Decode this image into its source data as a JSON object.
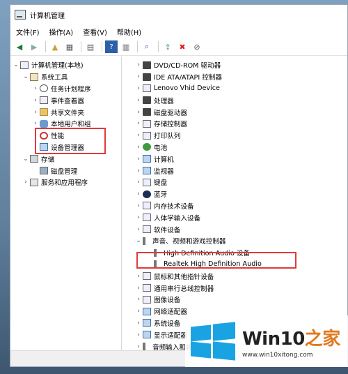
{
  "window": {
    "title": "计算机管理"
  },
  "menu": [
    "文件(F)",
    "操作(A)",
    "查看(V)",
    "帮助(H)"
  ],
  "toolbar_icons": [
    "back-icon",
    "forward-icon",
    "up-icon",
    "show-hide-tree-icon",
    "export-icon",
    "help-icon",
    "properties-icon",
    "scan-hardware-icon",
    "update-driver-icon",
    "uninstall-icon",
    "disable-icon"
  ],
  "left_tree": [
    {
      "label": "计算机管理(本地)",
      "level": 0,
      "chev": "∨",
      "icon": "computer-management-icon",
      "iconClass": "plain"
    },
    {
      "label": "系统工具",
      "level": 1,
      "chev": "∨",
      "icon": "system-tools-icon",
      "iconClass": "tools"
    },
    {
      "label": "任务计划程序",
      "level": 2,
      "chev": ">",
      "icon": "clock-icon",
      "iconClass": "clock"
    },
    {
      "label": "事件查看器",
      "level": 2,
      "chev": ">",
      "icon": "event-viewer-icon",
      "iconClass": "plain"
    },
    {
      "label": "共享文件夹",
      "level": 2,
      "chev": ">",
      "icon": "shared-folder-icon",
      "iconClass": "folder"
    },
    {
      "label": "本地用户和组",
      "level": 2,
      "chev": ">",
      "icon": "users-icon",
      "iconClass": "users"
    },
    {
      "label": "性能",
      "level": 2,
      "chev": ">",
      "icon": "performance-icon",
      "iconClass": "gauge"
    },
    {
      "label": "设备管理器",
      "level": 2,
      "chev": "",
      "icon": "device-manager-icon",
      "iconClass": "monitor"
    },
    {
      "label": "存储",
      "level": 1,
      "chev": "∨",
      "icon": "storage-icon",
      "iconClass": "storage"
    },
    {
      "label": "磁盘管理",
      "level": 2,
      "chev": "",
      "icon": "disk-management-icon",
      "iconClass": "disk"
    },
    {
      "label": "服务和应用程序",
      "level": 1,
      "chev": ">",
      "icon": "services-icon",
      "iconClass": "service"
    }
  ],
  "right_tree": [
    {
      "label": "DVD/CD-ROM 驱动器",
      "level": 0,
      "chev": ">",
      "icon": "dvd-icon",
      "iconClass": "dark"
    },
    {
      "label": "IDE ATA/ATAPI 控制器",
      "level": 0,
      "chev": ">",
      "icon": "ide-icon",
      "iconClass": "dark"
    },
    {
      "label": "Lenovo Vhid Device",
      "level": 0,
      "chev": ">",
      "icon": "hid-icon",
      "iconClass": "plain"
    },
    {
      "label": "处理器",
      "level": 0,
      "chev": ">",
      "icon": "processor-icon",
      "iconClass": "dark"
    },
    {
      "label": "磁盘驱动器",
      "level": 0,
      "chev": ">",
      "icon": "disk-drive-icon",
      "iconClass": "dark"
    },
    {
      "label": "存储控制器",
      "level": 0,
      "chev": ">",
      "icon": "storage-controller-icon",
      "iconClass": "plain"
    },
    {
      "label": "打印队列",
      "level": 0,
      "chev": ">",
      "icon": "printer-icon",
      "iconClass": "plain"
    },
    {
      "label": "电池",
      "level": 0,
      "chev": ">",
      "icon": "battery-icon",
      "iconClass": "green"
    },
    {
      "label": "计算机",
      "level": 0,
      "chev": ">",
      "icon": "computer-icon",
      "iconClass": "monitor"
    },
    {
      "label": "监视器",
      "level": 0,
      "chev": ">",
      "icon": "monitor-icon",
      "iconClass": "monitor"
    },
    {
      "label": "键盘",
      "level": 0,
      "chev": ">",
      "icon": "keyboard-icon",
      "iconClass": "plain"
    },
    {
      "label": "蓝牙",
      "level": 0,
      "chev": ">",
      "icon": "bluetooth-icon",
      "iconClass": "bt"
    },
    {
      "label": "内存技术设备",
      "level": 0,
      "chev": ">",
      "icon": "memory-icon",
      "iconClass": "plain"
    },
    {
      "label": "人体学输入设备",
      "level": 0,
      "chev": ">",
      "icon": "hid-input-icon",
      "iconClass": "plain"
    },
    {
      "label": "软件设备",
      "level": 0,
      "chev": ">",
      "icon": "software-device-icon",
      "iconClass": "plain"
    },
    {
      "label": "声音、视频和游戏控制器",
      "level": 0,
      "chev": "∨",
      "icon": "sound-icon",
      "iconClass": "speaker"
    },
    {
      "label": "High Definition Audio 设备",
      "level": 1,
      "chev": "",
      "icon": "audio-device-icon",
      "iconClass": "speaker"
    },
    {
      "label": "Realtek High Definition Audio",
      "level": 1,
      "chev": "",
      "icon": "audio-device-icon",
      "iconClass": "speaker"
    },
    {
      "label": "鼠标和其他指针设备",
      "level": 0,
      "chev": ">",
      "icon": "mouse-icon",
      "iconClass": "plain"
    },
    {
      "label": "通用串行总线控制器",
      "level": 0,
      "chev": ">",
      "icon": "usb-icon",
      "iconClass": "plain"
    },
    {
      "label": "图像设备",
      "level": 0,
      "chev": ">",
      "icon": "camera-icon",
      "iconClass": "plain"
    },
    {
      "label": "网络适配器",
      "level": 0,
      "chev": ">",
      "icon": "network-icon",
      "iconClass": "monitor"
    },
    {
      "label": "系统设备",
      "level": 0,
      "chev": ">",
      "icon": "system-device-icon",
      "iconClass": "monitor"
    },
    {
      "label": "显示适配器",
      "level": 0,
      "chev": ">",
      "icon": "display-adapter-icon",
      "iconClass": "monitor"
    },
    {
      "label": "音频输入和输出",
      "level": 0,
      "chev": ">",
      "icon": "audio-io-icon",
      "iconClass": "speaker"
    }
  ],
  "watermark": {
    "brand_a": "Win10",
    "brand_b": "之家",
    "url": "www.win10xitong.com"
  },
  "colors": {
    "highlight_box": "#e03a3a",
    "logo_blue": "#1aa3e2",
    "logo_orange": "#e07a1f"
  }
}
